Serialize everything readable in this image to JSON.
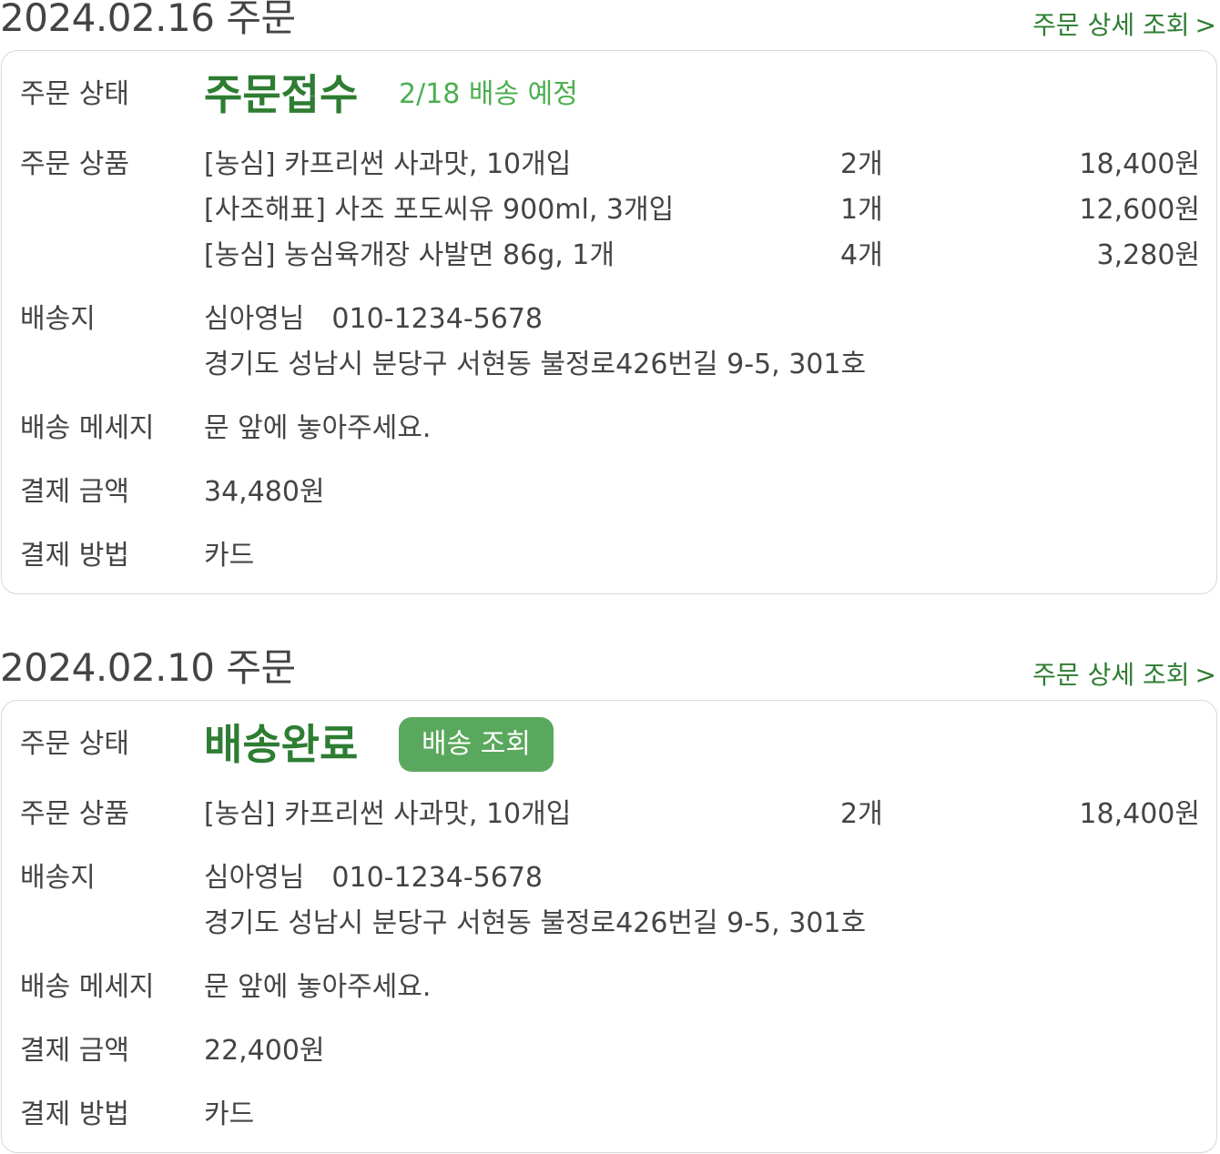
{
  "orders": [
    {
      "date_heading": "2024.02.16 주문",
      "detail_link": "주문 상세 조회",
      "status_label": "주문 상태",
      "status": "주문접수",
      "status_note": "2/18 배송 예정",
      "products_label": "주문 상품",
      "products": [
        {
          "name": "[농심] 카프리썬 사과맛, 10개입",
          "qty": "2개",
          "price": "18,400원"
        },
        {
          "name": "[사조해표] 사조 포도씨유 900ml, 3개입",
          "qty": "1개",
          "price": "12,600원"
        },
        {
          "name": "[농심] 농심육개장 사발면 86g, 1개",
          "qty": "4개",
          "price": "3,280원"
        }
      ],
      "address_label": "배송지",
      "recipient": "심아영님",
      "phone": "010-1234-5678",
      "address": "경기도 성남시 분당구 서현동 불정로426번길 9-5, 301호",
      "message_label": "배송 메세지",
      "message": "문 앞에 놓아주세요.",
      "amount_label": "결제 금액",
      "amount": "34,480원",
      "method_label": "결제 방법",
      "method": "카드"
    },
    {
      "date_heading": "2024.02.10 주문",
      "detail_link": "주문 상세 조회",
      "status_label": "주문 상태",
      "status": "배송완료",
      "track_button": "배송 조회",
      "products_label": "주문 상품",
      "products": [
        {
          "name": "[농심] 카프리썬 사과맛, 10개입",
          "qty": "2개",
          "price": "18,400원"
        }
      ],
      "address_label": "배송지",
      "recipient": "심아영님",
      "phone": "010-1234-5678",
      "address": "경기도 성남시 분당구 서현동 불정로426번길 9-5, 301호",
      "message_label": "배송 메세지",
      "message": "문 앞에 놓아주세요.",
      "amount_label": "결제 금액",
      "amount": "22,400원",
      "method_label": "결제 방법",
      "method": "카드"
    }
  ],
  "icons": {
    "detail_link_chevron": "chevron-right-icon"
  },
  "colors": {
    "accent_dark_green": "#2e7d32",
    "accent_light_green": "#4caf50",
    "button_green": "#5aa85d",
    "card_border": "#d8d8d8",
    "text": "#444444"
  }
}
